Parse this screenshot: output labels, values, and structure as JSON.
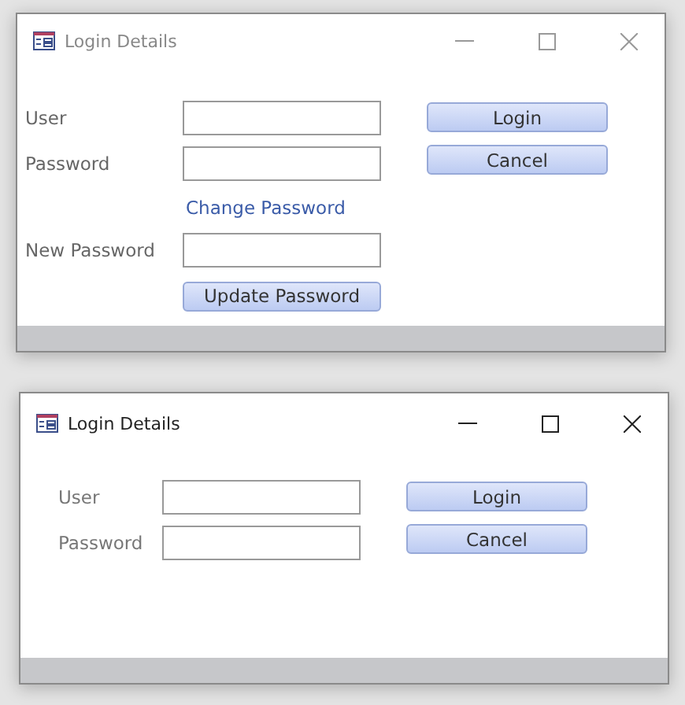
{
  "windows": [
    {
      "title": "Login Details",
      "active": false,
      "rows": [
        {
          "kind": "field",
          "label": "User"
        },
        {
          "kind": "field",
          "label": "Password"
        },
        {
          "kind": "link",
          "text": "Change Password"
        },
        {
          "kind": "field",
          "label": "New Password"
        },
        {
          "kind": "button",
          "text": "Update Password"
        }
      ],
      "buttons": [
        "Login",
        "Cancel"
      ]
    },
    {
      "title": "Login Details",
      "active": true,
      "rows": [
        {
          "kind": "field",
          "label": "User"
        },
        {
          "kind": "field",
          "label": "Password"
        }
      ],
      "buttons": [
        "Login",
        "Cancel"
      ]
    }
  ]
}
